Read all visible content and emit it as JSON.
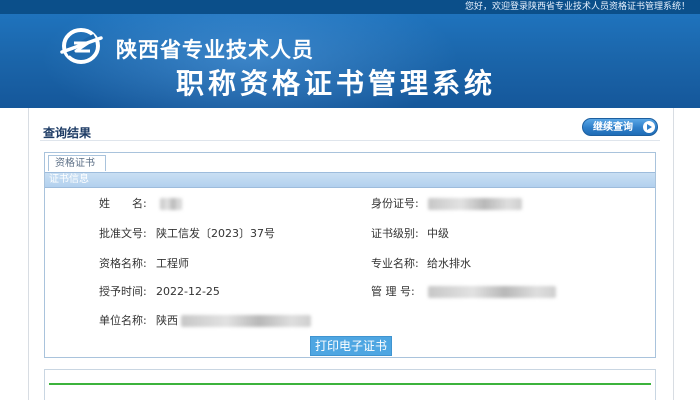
{
  "header": {
    "welcome_text": "您好，欢迎登录陕西省专业技术人员资格证书管理系统！",
    "title_line1": "陕西省专业技术人员",
    "title_line2": "职称资格证书管理系统",
    "logo_icon": "system-logo-icon"
  },
  "result": {
    "title": "查询结果",
    "continue_button": "继续查询"
  },
  "panel": {
    "tab_label": "资格证书",
    "section_title": "证书信息",
    "fields": [
      {
        "label": "姓　　名:",
        "value": ""
      },
      {
        "label": "身份证号:",
        "value": ""
      },
      {
        "label": "批准文号:",
        "value": "陕工信发〔2023〕37号"
      },
      {
        "label": "证书级别:",
        "value": "中级"
      },
      {
        "label": "资格名称:",
        "value": "工程师"
      },
      {
        "label": "专业名称:",
        "value": "给水排水"
      },
      {
        "label": "授予时间:",
        "value": "2022-12-25"
      },
      {
        "label": "管 理 号:",
        "value": ""
      },
      {
        "label": "单位名称:",
        "value": "陕西"
      }
    ],
    "print_button": "打印电子证书"
  },
  "colors": {
    "banner": "#1b66ab",
    "accent_button": "#4ea6e2",
    "section_header": "#b2d0ee",
    "divider_green": "#3cb33c"
  }
}
